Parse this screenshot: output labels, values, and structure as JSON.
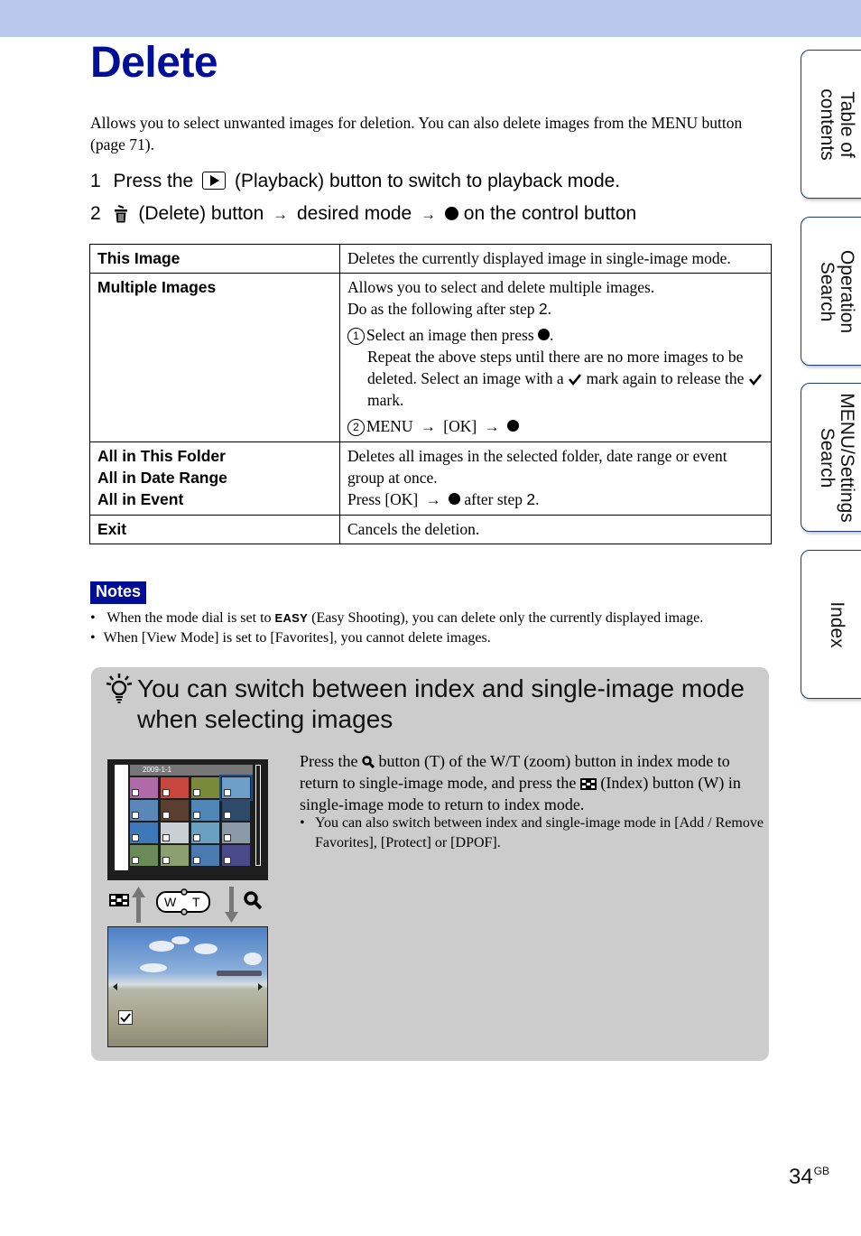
{
  "header": {
    "bar_color": "#b9c8ec"
  },
  "page": {
    "title": "Delete",
    "title_color": "#000f96",
    "intro": "Allows you to select unwanted images for deletion. You can also delete images from the MENU button (page 71).",
    "page_number": "34",
    "page_suffix": "GB"
  },
  "steps": [
    {
      "num": "1",
      "pre": "Press the",
      "icon": "playback-icon",
      "post": "(Playback) button to switch to playback mode."
    },
    {
      "num": "2",
      "icon": "trash-icon",
      "part1": "(Delete) button",
      "arrow1": "→",
      "part2": "desired mode",
      "arrow2": "→",
      "icon2": "control-button-center-dot",
      "part3": "on the control button"
    }
  ],
  "table": {
    "rows": [
      {
        "modes": [
          "This Image"
        ],
        "desc": [
          "Deletes the currently displayed image in single-image mode."
        ]
      },
      {
        "modes": [
          "Multiple Images"
        ],
        "desc": [
          "Allows you to select and delete multiple images.",
          "Do as the following after step ",
          "2",
          "."
        ],
        "sub1": {
          "marker": "1",
          "text": "Select an image then press",
          "cont": "Repeat the above steps until there are no more images to be deleted. Select an image with a",
          "cont2": "mark again to release the",
          "cont3": "mark."
        },
        "sub2": {
          "marker": "2",
          "text1": "MENU",
          "arrow": "→",
          "text2": "[OK]"
        }
      },
      {
        "modes": [
          "All in This Folder",
          "All in Date Range",
          "All in Event"
        ],
        "desc": [
          "Deletes all images in the selected folder, date range or event group at once.",
          "Press [OK]",
          "→",
          "after step ",
          "2",
          "."
        ]
      },
      {
        "modes": [
          "Exit"
        ],
        "desc": [
          "Cancels the deletion."
        ]
      }
    ]
  },
  "notes": {
    "label": "Notes",
    "items": [
      {
        "pre": "When the mode dial is set to",
        "icon": "EASY",
        "post": "(Easy Shooting), you can delete only the currently displayed image."
      },
      {
        "text": "When [View Mode] is set to [Favorites], you cannot delete images."
      }
    ]
  },
  "hint": {
    "title": "You can switch between index and single-image mode when selecting images",
    "text_pre": "Press the",
    "text_mid": "button (T) of the W/T (zoom) button in index mode to return to single-image mode, and press the",
    "text_post": "(Index) button (W) in single-image mode to return to index mode.",
    "bullet": "You can also switch between index and single-image mode in [Add / Remove Favorites], [Protect] or [DPOF].",
    "screen_date": "2009-1-1",
    "wt_w": "W",
    "wt_t": "T"
  },
  "side_tabs": [
    {
      "label_line1": "Table of",
      "label_line2": "contents"
    },
    {
      "label_line1": "Operation",
      "label_line2": "Search"
    },
    {
      "label_line1": "MENU/Settings",
      "label_line2": "Search"
    },
    {
      "label_line1": "Index",
      "label_line2": ""
    }
  ]
}
